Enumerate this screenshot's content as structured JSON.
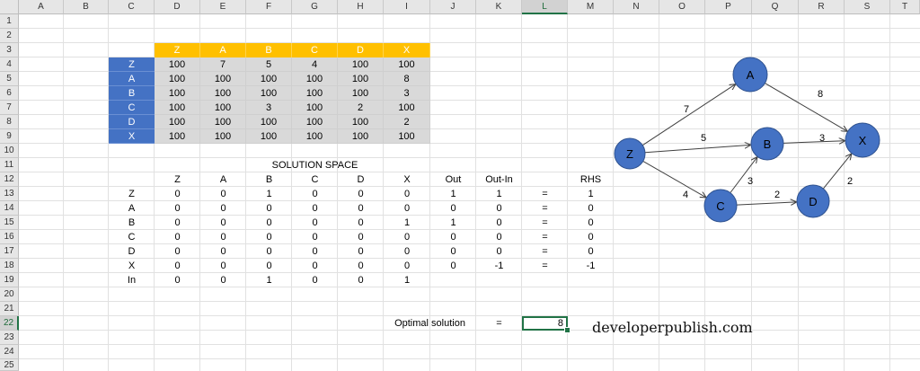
{
  "columns": [
    "A",
    "B",
    "C",
    "D",
    "E",
    "F",
    "G",
    "H",
    "I",
    "J",
    "K",
    "L",
    "M",
    "N",
    "O",
    "P",
    "Q",
    "R",
    "S",
    "T"
  ],
  "selected_column": "L",
  "rows": [
    "1",
    "2",
    "3",
    "4",
    "5",
    "6",
    "7",
    "8",
    "9",
    "10",
    "11",
    "12",
    "13",
    "14",
    "15",
    "16",
    "17",
    "18",
    "19",
    "20",
    "21",
    "22",
    "23",
    "24",
    "25"
  ],
  "selected_row": "22",
  "cost_matrix": {
    "col_headers": [
      "Z",
      "A",
      "B",
      "C",
      "D",
      "X"
    ],
    "row_headers": [
      "Z",
      "A",
      "B",
      "C",
      "D",
      "X"
    ],
    "values": [
      [
        "100",
        "7",
        "5",
        "4",
        "100",
        "100"
      ],
      [
        "100",
        "100",
        "100",
        "100",
        "100",
        "8"
      ],
      [
        "100",
        "100",
        "100",
        "100",
        "100",
        "3"
      ],
      [
        "100",
        "100",
        "3",
        "100",
        "2",
        "100"
      ],
      [
        "100",
        "100",
        "100",
        "100",
        "100",
        "2"
      ],
      [
        "100",
        "100",
        "100",
        "100",
        "100",
        "100"
      ]
    ],
    "header_color": "#ffc000",
    "row_header_color": "#4472c4",
    "body_color": "#d9d9d9"
  },
  "solution_space": {
    "title": "SOLUTION SPACE",
    "col_headers": [
      "Z",
      "A",
      "B",
      "C",
      "D",
      "X",
      "Out",
      "Out-In",
      "",
      "RHS"
    ],
    "rows": [
      {
        "label": "Z",
        "values": [
          "0",
          "0",
          "1",
          "0",
          "0",
          "0",
          "1",
          "1",
          "=",
          "1"
        ]
      },
      {
        "label": "A",
        "values": [
          "0",
          "0",
          "0",
          "0",
          "0",
          "0",
          "0",
          "0",
          "=",
          "0"
        ]
      },
      {
        "label": "B",
        "values": [
          "0",
          "0",
          "0",
          "0",
          "0",
          "1",
          "1",
          "0",
          "=",
          "0"
        ]
      },
      {
        "label": "C",
        "values": [
          "0",
          "0",
          "0",
          "0",
          "0",
          "0",
          "0",
          "0",
          "=",
          "0"
        ]
      },
      {
        "label": "D",
        "values": [
          "0",
          "0",
          "0",
          "0",
          "0",
          "0",
          "0",
          "0",
          "=",
          "0"
        ]
      },
      {
        "label": "X",
        "values": [
          "0",
          "0",
          "0",
          "0",
          "0",
          "0",
          "0",
          "-1",
          "=",
          "-1"
        ]
      },
      {
        "label": "In",
        "values": [
          "0",
          "0",
          "1",
          "0",
          "0",
          "1",
          "",
          "",
          "",
          ""
        ]
      }
    ]
  },
  "optimal": {
    "label": "Optimal solution",
    "equals": "=",
    "value": "8"
  },
  "watermark": "developerpublish.com",
  "network": {
    "node_color": "#4472c4",
    "nodes": [
      {
        "id": "Z"
      },
      {
        "id": "A"
      },
      {
        "id": "B"
      },
      {
        "id": "C"
      },
      {
        "id": "D"
      },
      {
        "id": "X"
      }
    ],
    "edges": [
      {
        "from": "Z",
        "to": "A",
        "label": "7"
      },
      {
        "from": "Z",
        "to": "B",
        "label": "5"
      },
      {
        "from": "Z",
        "to": "C",
        "label": "4"
      },
      {
        "from": "A",
        "to": "X",
        "label": "8"
      },
      {
        "from": "B",
        "to": "X",
        "label": "3"
      },
      {
        "from": "C",
        "to": "B",
        "label": "3"
      },
      {
        "from": "C",
        "to": "D",
        "label": "2"
      },
      {
        "from": "D",
        "to": "X",
        "label": "2"
      }
    ]
  }
}
